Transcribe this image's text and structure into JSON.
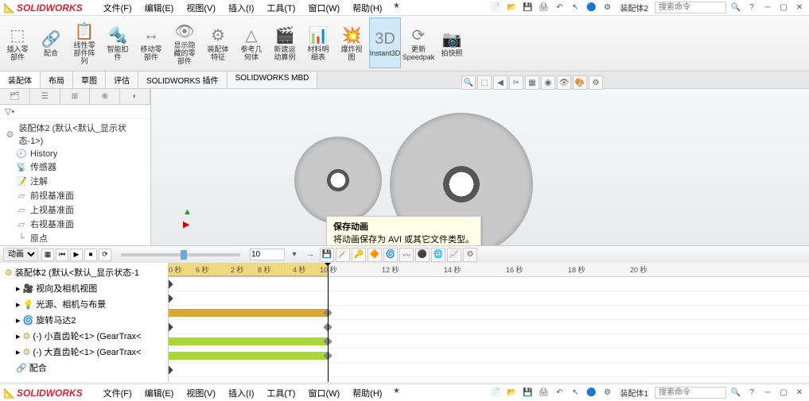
{
  "app": {
    "name": "SOLIDWORKS",
    "doc": "装配体2"
  },
  "menu": [
    "文件(F)",
    "编辑(E)",
    "视图(V)",
    "插入(I)",
    "工具(T)",
    "窗口(W)",
    "帮助(H)"
  ],
  "search": {
    "placeholder": "搜索命令"
  },
  "ribbon": [
    {
      "icon": "⬚",
      "label": "插入零部件"
    },
    {
      "icon": "🔗",
      "label": "配合"
    },
    {
      "icon": "📋",
      "label": "线性零部件阵列"
    },
    {
      "icon": "🔩",
      "label": "智能扣件"
    },
    {
      "icon": "↔",
      "label": "移动零部件"
    },
    {
      "icon": "👁",
      "label": "显示隐藏的零部件"
    },
    {
      "icon": "⚙",
      "label": "装配体特征"
    },
    {
      "icon": "△",
      "label": "参考几何体"
    },
    {
      "icon": "🎬",
      "label": "新建运动算例"
    },
    {
      "icon": "📊",
      "label": "材料明细表"
    },
    {
      "icon": "💥",
      "label": "爆炸视图"
    },
    {
      "icon": "3D",
      "label": "Instant3D",
      "active": true
    },
    {
      "icon": "⟳",
      "label": "更新Speedpak"
    },
    {
      "icon": "📷",
      "label": "拍快照"
    }
  ],
  "tabs": [
    "装配体",
    "布局",
    "草图",
    "评估",
    "SOLIDWORKS 插件",
    "SOLIDWORKS MBD"
  ],
  "tree": {
    "root": "装配体2 (默认<默认_显示状态-1>)",
    "items": [
      {
        "icon": "🕘",
        "label": "History"
      },
      {
        "icon": "📡",
        "label": "传感器"
      },
      {
        "icon": "📝",
        "label": "注解"
      },
      {
        "icon": "▱",
        "label": "前视基准面"
      },
      {
        "icon": "▱",
        "label": "上视基准面"
      },
      {
        "icon": "▱",
        "label": "右视基准面"
      },
      {
        "icon": "└",
        "label": "原点"
      }
    ]
  },
  "tooltip": {
    "title": "保存动画",
    "body": "将动画保存为 AVI 或其它文件类型。"
  },
  "motion": {
    "study": "动画",
    "time": "10"
  },
  "timeline": {
    "ticks": [
      "0 秒",
      "2 秒",
      "4 秒",
      "6 秒",
      "8 秒",
      "10 秒",
      "12 秒",
      "14 秒",
      "16 秒",
      "18 秒",
      "20 秒"
    ],
    "tree": [
      {
        "icon": "⚙",
        "label": "装配体2 (默认<默认_显示状态-1"
      },
      {
        "icon": "🎥",
        "label": "视向及相机视图"
      },
      {
        "icon": "💡",
        "label": "光源、相机与布景"
      },
      {
        "icon": "🌀",
        "label": "旋转马达2"
      },
      {
        "icon": "⚙",
        "label": "(-) 小直齿轮<1> (GearTrax<"
      },
      {
        "icon": "⚙",
        "label": "(-) 大直齿轮<1> (GearTrax<"
      },
      {
        "icon": "🔗",
        "label": "配合"
      }
    ]
  },
  "doc2": "装配体1"
}
